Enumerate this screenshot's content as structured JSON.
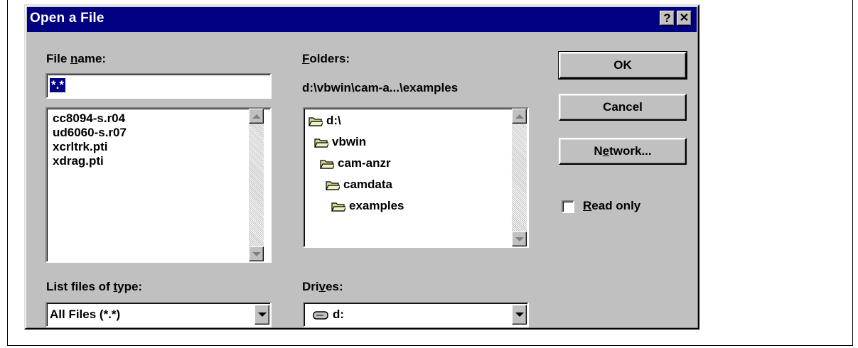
{
  "window": {
    "title": "Open a File",
    "help_glyph": "?",
    "close_glyph": "✕"
  },
  "file_name": {
    "label_pre": "File ",
    "label_u": "n",
    "label_post": "ame:",
    "value": "*.*",
    "files": [
      "cc8094-s.r04",
      "ud6060-s.r07",
      "xcrltrk.pti",
      "xdrag.pti"
    ]
  },
  "folders": {
    "label_u": "F",
    "label_post": "olders:",
    "current_path": "d:\\vbwin\\cam-a...\\examples",
    "items": [
      "d:\\",
      "vbwin",
      "cam-anzr",
      "camdata",
      "examples"
    ]
  },
  "file_type": {
    "label_pre": "List files of ",
    "label_u": "t",
    "label_post": "ype:",
    "selected": "All Files (*.*)"
  },
  "drives": {
    "label_pre": "Dri",
    "label_u": "v",
    "label_post": "es:",
    "selected": "d:",
    "icon": "drive-icon"
  },
  "buttons": {
    "ok": "OK",
    "cancel": "Cancel",
    "network_pre": "N",
    "network_u": "e",
    "network_post": "twork..."
  },
  "read_only": {
    "label_u": "R",
    "label_post": "ead only",
    "checked": false
  },
  "colors": {
    "titlebar": "#000080",
    "face": "#c0c0c0",
    "folder": "#d8d890"
  }
}
